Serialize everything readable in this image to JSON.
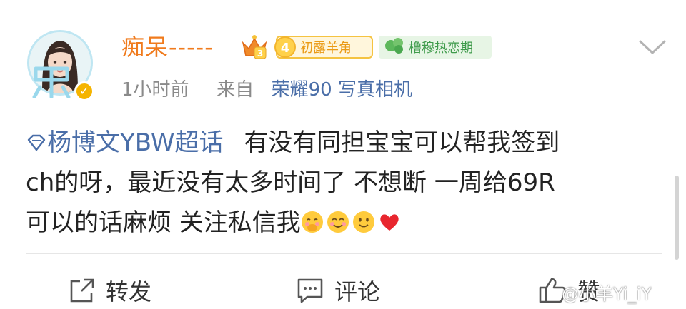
{
  "user": {
    "name": "痴呆-----",
    "level": "4",
    "level_label": "初露羊角",
    "fan_label": "橹穆热恋期",
    "verified_mark": "✓"
  },
  "meta": {
    "time": "1小时前",
    "from": "来自",
    "source": "荣耀90 写真相机"
  },
  "post": {
    "topic": "杨博文YBW超话",
    "line1": "有没有同担宝宝可以帮我签到",
    "line2": "ch的呀，最近没有太多时间了 不想断 一周给69R",
    "line3": "可以的话麻烦 关注私信我"
  },
  "actions": {
    "repost": "转发",
    "comment": "评论",
    "like": "赞"
  },
  "watermark": "@小羊Yi_iY",
  "icons": [
    "avatar-frame",
    "crown-icon",
    "level-badge",
    "clover-icon",
    "chevron-down-icon",
    "repost-icon",
    "comment-icon",
    "like-icon",
    "topic-icon",
    "emoji-hush",
    "emoji-smile",
    "emoji-slight-smile",
    "heart-icon"
  ],
  "colors": {
    "username": "#f07b1d",
    "link": "#4a6ea8",
    "meta": "#8a8a8a",
    "level_badge": "#ffd14a",
    "fan_badge_bg": "#e7f5e5",
    "heart": "#e8262e"
  }
}
